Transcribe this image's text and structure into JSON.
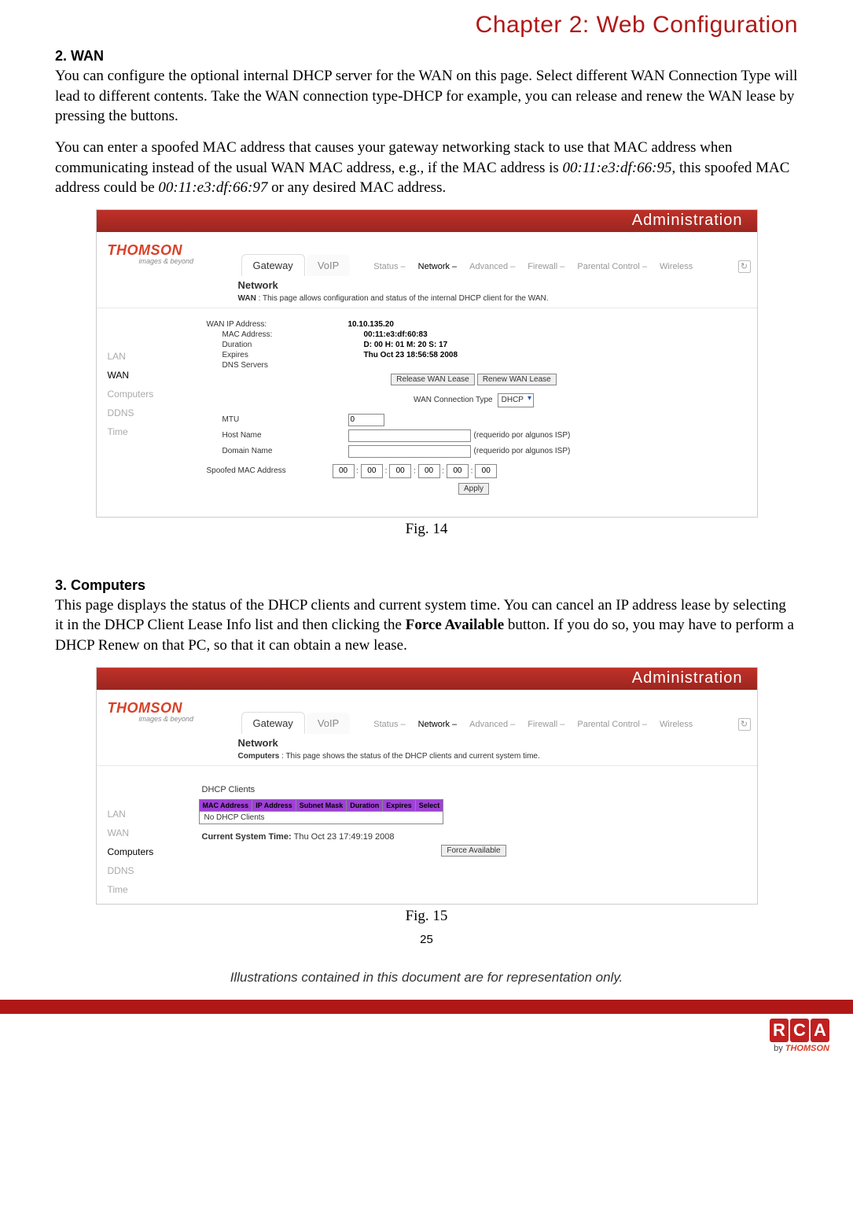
{
  "chapter_title": "Chapter 2: Web Configuration",
  "page_number": "25",
  "footer_note": "Illustrations contained in this document are for representation only.",
  "section_wan": {
    "heading": "2. WAN",
    "p1": "You can configure the optional internal DHCP server for the WAN on this page. Select different WAN Connection Type will lead to different contents. Take the WAN connection type-DHCP for example, you can release and renew the WAN lease by pressing the buttons.",
    "p2a": "You can enter a spoofed MAC address that causes your gateway networking stack to use that MAC address when communicating instead of the usual WAN MAC address, e.g., if the MAC address is ",
    "p2_mac1": "00:11:e3:df:66:95",
    "p2b": ", this spoofed MAC address could be ",
    "p2_mac2": "00:11:e3:df:66:97",
    "p2c": " or any desired MAC address.",
    "caption": "Fig. 14"
  },
  "section_comp": {
    "heading": "3. Computers",
    "p1a": "This page displays the status of the DHCP clients and current system time. You can cancel an IP address lease by selecting it in the DHCP Client Lease Info list and then clicking the ",
    "p1_bold": "Force Available",
    "p1b": " button. If you do so, you may have to perform a DHCP Renew on that PC, so that it can obtain a new lease.",
    "caption": "Fig. 15"
  },
  "ss_common": {
    "logo_main": "THOMSON",
    "logo_sub": "images & beyond",
    "admin": "Administration",
    "tabs": {
      "gateway": "Gateway",
      "voip": "VoIP"
    },
    "subnav": {
      "status": "Status –",
      "network": "Network –",
      "advanced": "Advanced –",
      "firewall": "Firewall –",
      "parental": "Parental Control –",
      "wireless": "Wireless"
    },
    "sidebar": {
      "lan": "LAN",
      "wan": "WAN",
      "computers": "Computers",
      "ddns": "DDNS",
      "time": "Time"
    },
    "network_title": "Network"
  },
  "ss_wan": {
    "desc_label": "WAN",
    "desc_text": " : This page allows configuration and status of the internal DHCP client for the WAN.",
    "fields": {
      "wan_ip_label": "WAN IP Address:",
      "wan_ip_value": "10.10.135.20",
      "mac_label": "MAC Address:",
      "mac_value": "00:11:e3:df:60:83",
      "duration_label": "Duration",
      "duration_value": "D: 00 H: 01 M: 20 S: 17",
      "expires_label": "Expires",
      "expires_value": "Thu Oct 23 18:56:58 2008",
      "dns_label": "DNS Servers"
    },
    "buttons": {
      "release": "Release WAN Lease",
      "renew": "Renew WAN Lease",
      "apply": "Apply"
    },
    "conn_type_label": "WAN Connection Type",
    "conn_type_value": "DHCP",
    "mtu_label": "MTU",
    "mtu_value": "0",
    "host_label": "Host Name",
    "domain_label": "Domain Name",
    "isp_note": "(requerido por algunos ISP)",
    "spoof_label": "Spoofed MAC Address",
    "spoof_vals": [
      "00",
      "00",
      "00",
      "00",
      "00",
      "00"
    ]
  },
  "ss_comp": {
    "desc_label": "Computers",
    "desc_text": " : This page shows the status of the DHCP clients and current system time.",
    "dhcp_title": "DHCP Clients",
    "table_headers": [
      "MAC Address",
      "IP Address",
      "Subnet Mask",
      "Duration",
      "Expires",
      "Select"
    ],
    "no_clients": "No DHCP Clients",
    "curr_time_label": "Current System Time: ",
    "curr_time_value": "Thu Oct 23 17:49:19 2008",
    "force_btn": "Force Available"
  },
  "bottom": {
    "rca": [
      "R",
      "C",
      "A"
    ],
    "by": "by ",
    "thomson": "THOMSON"
  }
}
